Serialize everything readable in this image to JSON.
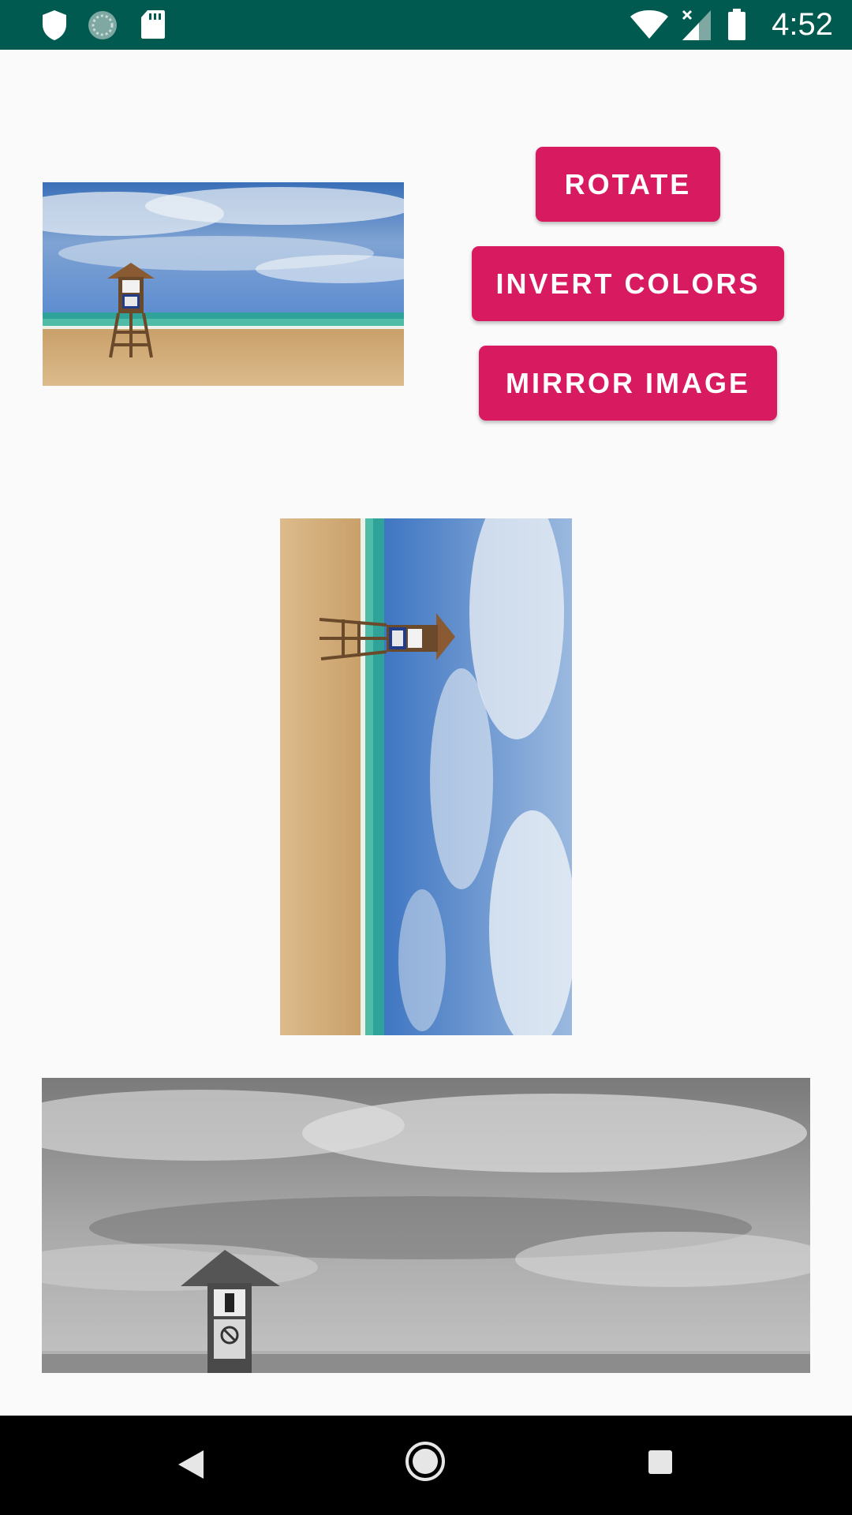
{
  "status_bar": {
    "time": "4:52",
    "icons": [
      "shield-icon",
      "sync-icon",
      "sd-card-icon",
      "wifi-icon",
      "signal-icon",
      "battery-icon"
    ]
  },
  "actions": {
    "rotate_label": "ROTATE",
    "invert_label": "INVERT COLORS",
    "mirror_label": "MIRROR IMAGE",
    "button_color": "#d81b60"
  },
  "images": {
    "original": "beach-lifeguard-tower-photo",
    "rotated": "rotated-beach-photo",
    "grayscale": "grayscale-beach-photo"
  },
  "navigation": {
    "icons": [
      "back-icon",
      "home-icon",
      "recents-icon"
    ]
  }
}
